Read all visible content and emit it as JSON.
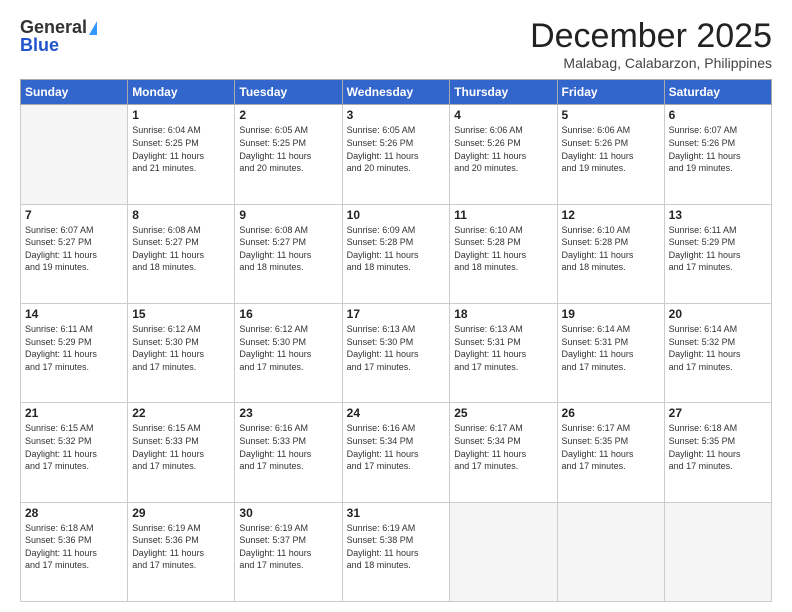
{
  "header": {
    "logo_general": "General",
    "logo_blue": "Blue",
    "month_title": "December 2025",
    "location": "Malabag, Calabarzon, Philippines"
  },
  "weekdays": [
    "Sunday",
    "Monday",
    "Tuesday",
    "Wednesday",
    "Thursday",
    "Friday",
    "Saturday"
  ],
  "weeks": [
    [
      {
        "day": "",
        "info": ""
      },
      {
        "day": "1",
        "info": "Sunrise: 6:04 AM\nSunset: 5:25 PM\nDaylight: 11 hours\nand 21 minutes."
      },
      {
        "day": "2",
        "info": "Sunrise: 6:05 AM\nSunset: 5:25 PM\nDaylight: 11 hours\nand 20 minutes."
      },
      {
        "day": "3",
        "info": "Sunrise: 6:05 AM\nSunset: 5:26 PM\nDaylight: 11 hours\nand 20 minutes."
      },
      {
        "day": "4",
        "info": "Sunrise: 6:06 AM\nSunset: 5:26 PM\nDaylight: 11 hours\nand 20 minutes."
      },
      {
        "day": "5",
        "info": "Sunrise: 6:06 AM\nSunset: 5:26 PM\nDaylight: 11 hours\nand 19 minutes."
      },
      {
        "day": "6",
        "info": "Sunrise: 6:07 AM\nSunset: 5:26 PM\nDaylight: 11 hours\nand 19 minutes."
      }
    ],
    [
      {
        "day": "7",
        "info": "Sunrise: 6:07 AM\nSunset: 5:27 PM\nDaylight: 11 hours\nand 19 minutes."
      },
      {
        "day": "8",
        "info": "Sunrise: 6:08 AM\nSunset: 5:27 PM\nDaylight: 11 hours\nand 18 minutes."
      },
      {
        "day": "9",
        "info": "Sunrise: 6:08 AM\nSunset: 5:27 PM\nDaylight: 11 hours\nand 18 minutes."
      },
      {
        "day": "10",
        "info": "Sunrise: 6:09 AM\nSunset: 5:28 PM\nDaylight: 11 hours\nand 18 minutes."
      },
      {
        "day": "11",
        "info": "Sunrise: 6:10 AM\nSunset: 5:28 PM\nDaylight: 11 hours\nand 18 minutes."
      },
      {
        "day": "12",
        "info": "Sunrise: 6:10 AM\nSunset: 5:28 PM\nDaylight: 11 hours\nand 18 minutes."
      },
      {
        "day": "13",
        "info": "Sunrise: 6:11 AM\nSunset: 5:29 PM\nDaylight: 11 hours\nand 17 minutes."
      }
    ],
    [
      {
        "day": "14",
        "info": "Sunrise: 6:11 AM\nSunset: 5:29 PM\nDaylight: 11 hours\nand 17 minutes."
      },
      {
        "day": "15",
        "info": "Sunrise: 6:12 AM\nSunset: 5:30 PM\nDaylight: 11 hours\nand 17 minutes."
      },
      {
        "day": "16",
        "info": "Sunrise: 6:12 AM\nSunset: 5:30 PM\nDaylight: 11 hours\nand 17 minutes."
      },
      {
        "day": "17",
        "info": "Sunrise: 6:13 AM\nSunset: 5:30 PM\nDaylight: 11 hours\nand 17 minutes."
      },
      {
        "day": "18",
        "info": "Sunrise: 6:13 AM\nSunset: 5:31 PM\nDaylight: 11 hours\nand 17 minutes."
      },
      {
        "day": "19",
        "info": "Sunrise: 6:14 AM\nSunset: 5:31 PM\nDaylight: 11 hours\nand 17 minutes."
      },
      {
        "day": "20",
        "info": "Sunrise: 6:14 AM\nSunset: 5:32 PM\nDaylight: 11 hours\nand 17 minutes."
      }
    ],
    [
      {
        "day": "21",
        "info": "Sunrise: 6:15 AM\nSunset: 5:32 PM\nDaylight: 11 hours\nand 17 minutes."
      },
      {
        "day": "22",
        "info": "Sunrise: 6:15 AM\nSunset: 5:33 PM\nDaylight: 11 hours\nand 17 minutes."
      },
      {
        "day": "23",
        "info": "Sunrise: 6:16 AM\nSunset: 5:33 PM\nDaylight: 11 hours\nand 17 minutes."
      },
      {
        "day": "24",
        "info": "Sunrise: 6:16 AM\nSunset: 5:34 PM\nDaylight: 11 hours\nand 17 minutes."
      },
      {
        "day": "25",
        "info": "Sunrise: 6:17 AM\nSunset: 5:34 PM\nDaylight: 11 hours\nand 17 minutes."
      },
      {
        "day": "26",
        "info": "Sunrise: 6:17 AM\nSunset: 5:35 PM\nDaylight: 11 hours\nand 17 minutes."
      },
      {
        "day": "27",
        "info": "Sunrise: 6:18 AM\nSunset: 5:35 PM\nDaylight: 11 hours\nand 17 minutes."
      }
    ],
    [
      {
        "day": "28",
        "info": "Sunrise: 6:18 AM\nSunset: 5:36 PM\nDaylight: 11 hours\nand 17 minutes."
      },
      {
        "day": "29",
        "info": "Sunrise: 6:19 AM\nSunset: 5:36 PM\nDaylight: 11 hours\nand 17 minutes."
      },
      {
        "day": "30",
        "info": "Sunrise: 6:19 AM\nSunset: 5:37 PM\nDaylight: 11 hours\nand 17 minutes."
      },
      {
        "day": "31",
        "info": "Sunrise: 6:19 AM\nSunset: 5:38 PM\nDaylight: 11 hours\nand 18 minutes."
      },
      {
        "day": "",
        "info": ""
      },
      {
        "day": "",
        "info": ""
      },
      {
        "day": "",
        "info": ""
      }
    ]
  ]
}
